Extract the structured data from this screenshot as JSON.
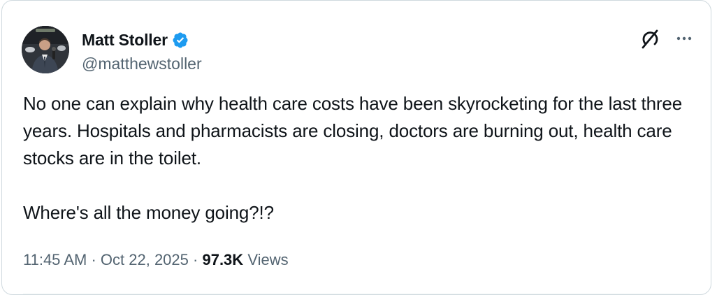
{
  "author": {
    "display_name": "Matt Stoller",
    "handle": "@matthewstoller",
    "verified": true,
    "avatar_icon": "profile-photo"
  },
  "tweet": {
    "text": "No one can explain why health care costs have been skyrocketing for the last three years. Hospitals and pharmacists are closing, doctors are burning out, health care stocks are in the toilet.\n\nWhere's all the money going?!?",
    "time": "11:45 AM",
    "separator": "·",
    "date": "Oct 22, 2025",
    "views_count": "97.3K",
    "views_label": "Views"
  },
  "actions": {
    "grok_icon": "grok-icon",
    "more_icon": "more-options-icon"
  },
  "colors": {
    "verified_blue": "#1d9bf0",
    "text_primary": "#0f1419",
    "text_secondary": "#536471",
    "border": "#cfd9de"
  }
}
